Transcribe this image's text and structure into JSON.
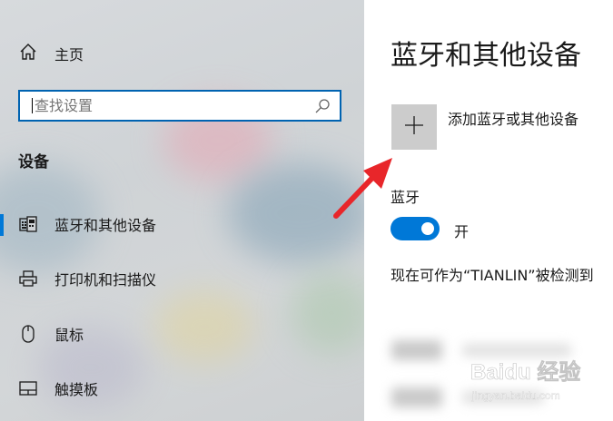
{
  "sidebar": {
    "home_label": "主页",
    "search_placeholder": "查找设置",
    "section_title": "设备",
    "items": [
      {
        "label": "蓝牙和其他设备",
        "icon": "keyboard-device-icon",
        "selected": true
      },
      {
        "label": "打印机和扫描仪",
        "icon": "printer-icon",
        "selected": false
      },
      {
        "label": "鼠标",
        "icon": "mouse-icon",
        "selected": false
      },
      {
        "label": "触摸板",
        "icon": "touchpad-icon",
        "selected": false
      }
    ]
  },
  "main": {
    "title": "蓝牙和其他设备",
    "add_device_label": "添加蓝牙或其他设备",
    "bluetooth_label": "蓝牙",
    "bluetooth_on": true,
    "toggle_state_label": "开",
    "discoverable_text": "现在可作为“TIANLIN”被检测到"
  },
  "watermark": {
    "brand": "Baidu 经验",
    "url": "jingyan.baidu.com"
  },
  "colors": {
    "accent": "#0078d7",
    "search_border": "#0063b1",
    "arrow": "#e8262a",
    "add_tile": "#cccccc"
  }
}
